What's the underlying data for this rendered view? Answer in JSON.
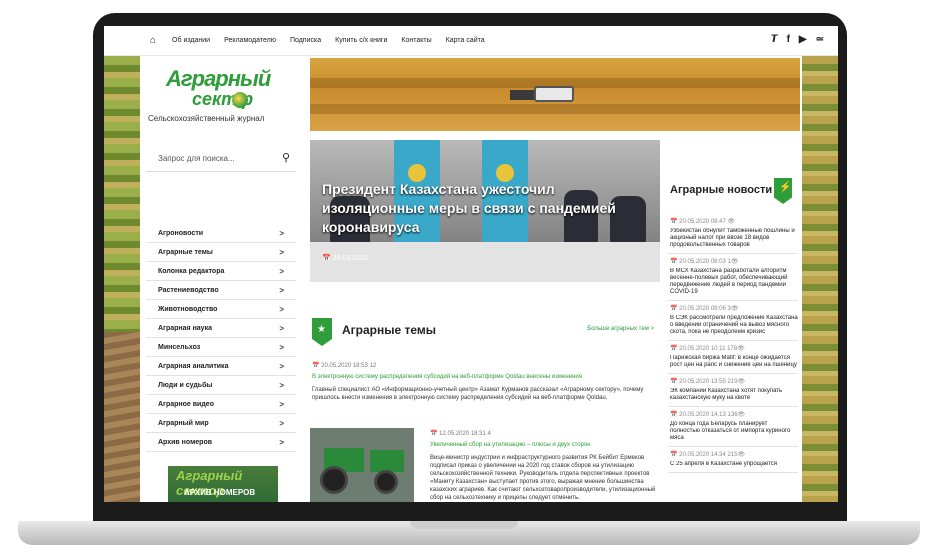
{
  "nav": {
    "home_icon": "home-icon",
    "links": [
      "Об издании",
      "Рекламодателю",
      "Подписка",
      "Купить с/х книги",
      "Контакты",
      "Карта сайта"
    ],
    "social": [
      "twitter-icon",
      "facebook-icon",
      "youtube-icon",
      "rss-icon"
    ]
  },
  "logo": {
    "word1": "Аграрный",
    "word2": "сект р",
    "tagline": "Сельскохозяйственный журнал"
  },
  "search": {
    "placeholder": "Запрос для поиска..."
  },
  "categories": [
    "Агроновости",
    "Аграрные темы",
    "Колонка редактора",
    "Растениеводство",
    "Животноводство",
    "Аграрная наука",
    "Минсельхоз",
    "Аграрная аналитика",
    "Люди и судьбы",
    "Аграрное видео",
    "Аграрный мир",
    "Архив номеров"
  ],
  "archive_banner": {
    "word": "Аграрный сектор",
    "label": "АРХИВ НОМЕРОВ"
  },
  "hero": {
    "title": "Президент Казахстана ужесточил изоляционные меры в связи с пандемией коронавируса",
    "date": "20.03.2020"
  },
  "themes": {
    "title": "Аграрные темы",
    "more": "Больше аграрных тем",
    "item1": {
      "meta": "20.05.2020 18:53   12",
      "title": "В электронную систему распределения субсидий на веб-платформе Qoldau внесены изменения",
      "text": "Главный специалист АО «Информационно-учетный центр» Азамат Курманов рассказал «Аграрному сектору», почему пришлось внести изменения в электронную систему распределения субсидий на веб-платформе Qoldau."
    },
    "item2": {
      "meta": "12.05.2020 18:31   4",
      "title": "Увеличенный сбор на утилизацию – плюсы и двух сторон",
      "text": "Вице-министр индустрии и инфраструктурного развития РК Бейбит Ермеков подписал приказ о увеличении на 2020 год ставок сборов на утилизацию сельскохозяйственной техники. Руководитель отдела перспективных проектов «Маниту Казахстан» выступает против этого, выражая мнение большинства казахских аграриев. Как считают сельхозтоваропроизводители, утилизационный сбор на сельхозтехнику и прицепы следует отменить."
    }
  },
  "news": {
    "title": "Аграрные новости",
    "items": [
      {
        "meta": "20.05.2020 08:47   ",
        "text": "Узбекистан обнулит таможенные пошлины и акцизный налог при ввозе 18 видов продовольственных товаров"
      },
      {
        "meta": "20.05.2020 08:03   1",
        "text": "В МСХ Казахстана разработали алгоритм весенне-полевых работ, обеспечивающий передвижение людей в период пандемии COVID-19"
      },
      {
        "meta": "20.05.2020 09:06   3",
        "text": "В СЭК рассмотрели предложение Казахстана о введении ограничений на вывоз мясного скота, пока не преодолеем кризис"
      },
      {
        "meta": "20.05.2020 10:11   178",
        "text": "Парижская биржа Matif: в конце ожидается рост цен на рапс и снижение цен на пшеницу"
      },
      {
        "meta": "20.05.2020 13:55   219",
        "text": "ЭК компании Казахстана хотят покупать казахстанскую муку на квоте"
      },
      {
        "meta": "20.05.2020 14:13   136",
        "text": "До конца года Беларусь планирует полностью отказаться от импорта куриного мяса"
      },
      {
        "meta": "20.05.2020 14:34   215",
        "text": "С 25 апреля в Казахстане упрощается"
      }
    ]
  }
}
